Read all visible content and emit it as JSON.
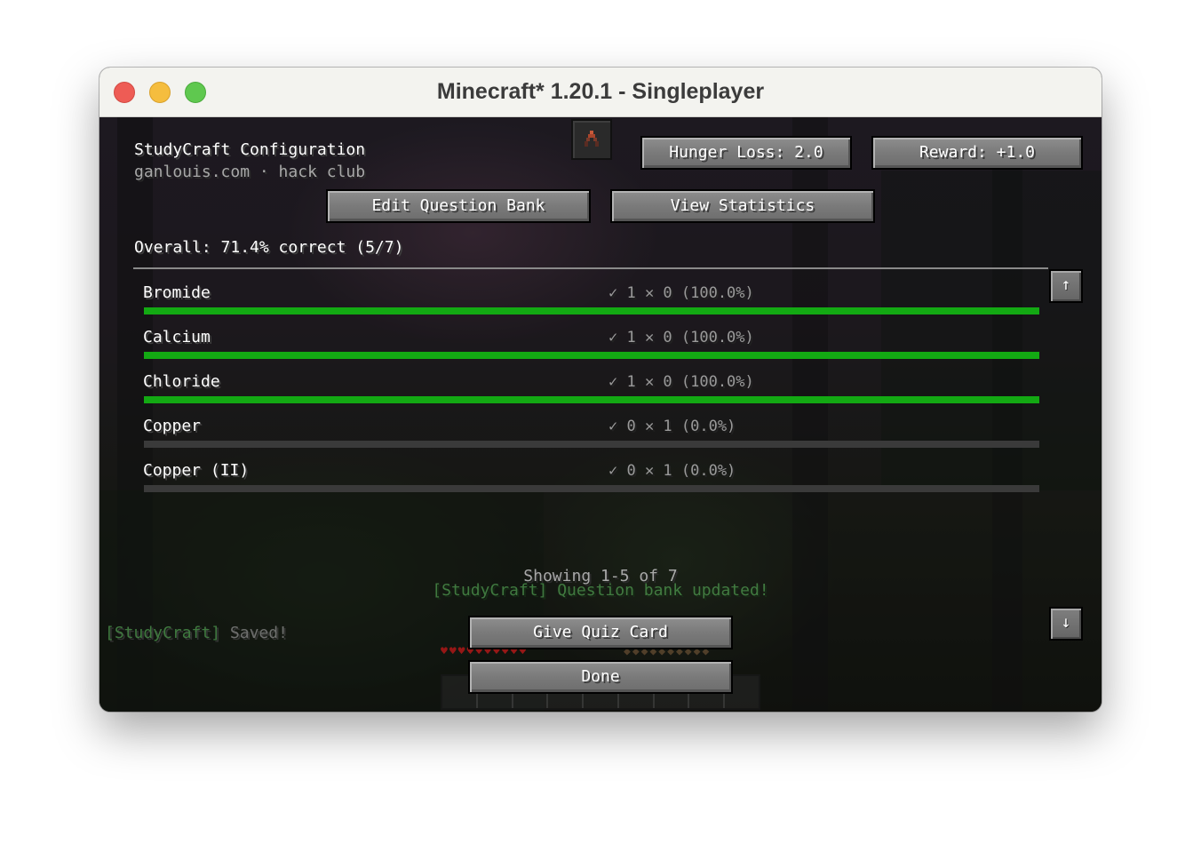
{
  "window": {
    "title": "Minecraft* 1.20.1 - Singleplayer"
  },
  "header": {
    "title": "StudyCraft Configuration",
    "subtitle": "ganlouis.com · hack club",
    "hunger_loss_label": "Hunger Loss: 2.0",
    "reward_label": "Reward: +1.0",
    "edit_bank_label": "Edit Question Bank",
    "view_stats_label": "View Statistics",
    "item_icon": "quiz-card-item-icon"
  },
  "summary": {
    "overall": "Overall: 71.4% correct (5/7)"
  },
  "stats_list": {
    "rows": [
      {
        "name": "Bromide",
        "stats": "✓ 1  ✕ 0  (100.0%)",
        "ratio": 1.0
      },
      {
        "name": "Calcium",
        "stats": "✓ 1  ✕ 0  (100.0%)",
        "ratio": 1.0
      },
      {
        "name": "Chloride",
        "stats": "✓ 1  ✕ 0  (100.0%)",
        "ratio": 1.0
      },
      {
        "name": "Copper",
        "stats": "✓ 0  ✕ 1  (0.0%)",
        "ratio": 0.0
      },
      {
        "name": "Copper (II)",
        "stats": "✓ 0  ✕ 1  (0.0%)",
        "ratio": 0.0
      }
    ],
    "scroll_up_glyph": "↑",
    "scroll_down_glyph": "↓"
  },
  "pagination": {
    "text": "Showing 1-5 of 7"
  },
  "chat": {
    "message_1": "[StudyCraft] Question bank updated!",
    "message_2_prefix": "[StudyCraft]",
    "message_2_text": "Saved!"
  },
  "footer": {
    "give_card_label": "Give Quiz Card",
    "done_label": "Done"
  },
  "hud": {
    "hearts": "♥♥♥♥♥♥♥♥♥♥",
    "food": "◆◆◆◆◆◆◆◆◆◆"
  },
  "colors": {
    "bar_fill": "#13a913",
    "bar_empty": "#3a3a3a",
    "chat_green": "#4f9a4f"
  }
}
